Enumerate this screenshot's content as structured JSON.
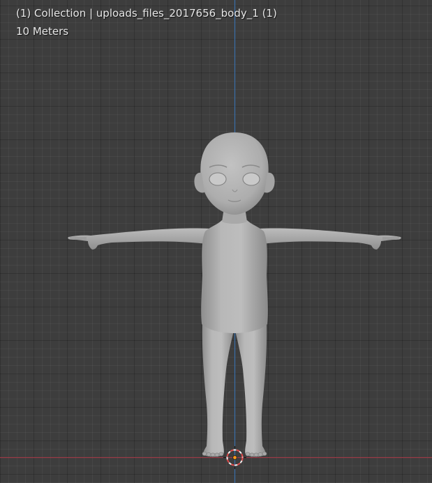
{
  "viewport": {
    "header_text": "(1) Collection | uploads_files_2017656_body_1 (1)",
    "scale_text": "10 Meters"
  },
  "colors": {
    "background": "#3d3d3d",
    "axis_x": "#9b3a46",
    "axis_z": "#3a6ea8",
    "mesh": "#b4b4b4",
    "origin_cursor": "#e0e0e0",
    "origin_dot": "#ff9a1a"
  },
  "icons": {
    "origin": "3d-cursor-icon",
    "object_origin": "object-origin-dot"
  }
}
